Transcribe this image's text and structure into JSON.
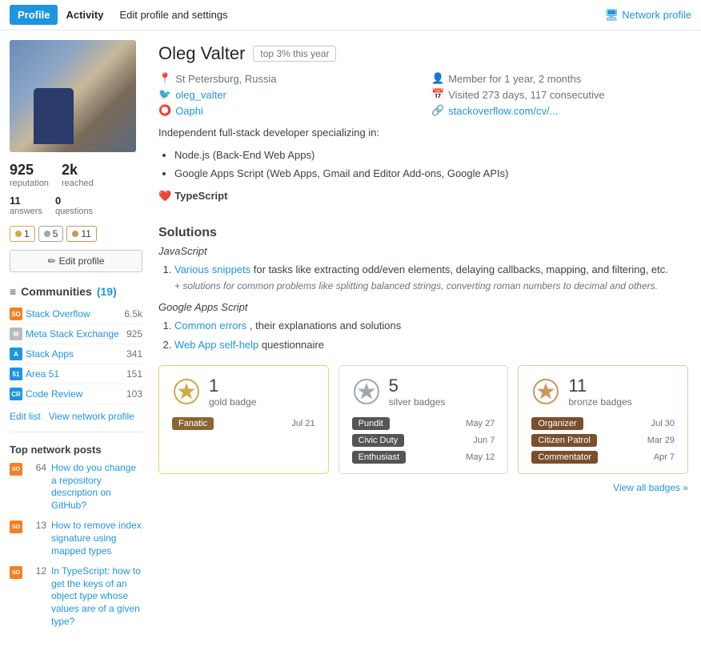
{
  "nav": {
    "profile_tab": "Profile",
    "activity_tab": "Activity",
    "edit_link": "Edit profile and settings",
    "network_profile": "Network profile"
  },
  "user": {
    "name": "Oleg Valter",
    "top_pct": "top 3% this year",
    "location": "St Petersburg, Russia",
    "member_since": "Member for 1 year, 2 months",
    "twitter": "oleg_valter",
    "visited": "Visited 273 days, 117 consecutive",
    "github": "Oaphi",
    "website": "stackoverflow.com/cv/...",
    "reputation": "925",
    "reputation_label": "reputation",
    "reached": "2k",
    "reached_label": "reached",
    "answers": "11",
    "answers_label": "answers",
    "questions": "0",
    "questions_label": "questions",
    "badge_gold": "1",
    "badge_silver": "5",
    "badge_bronze": "11",
    "edit_profile_btn": "Edit profile"
  },
  "bio": {
    "intro": "Independent full-stack developer specializing in:",
    "items": [
      "Node.js (Back-End Web Apps)",
      "Google Apps Script (Web Apps, Gmail and Editor Add-ons, Google APIs)"
    ],
    "ts_label": "TypeScript"
  },
  "solutions": {
    "title": "Solutions",
    "js_title": "JavaScript",
    "js_items": [
      {
        "link_text": "Various snippets",
        "link_rest": " for tasks like extracting odd/even elements, delaying callbacks, mapping, and filtering, etc.",
        "additional": "+ solutions for common problems like splitting balanced strings, converting roman numbers to decimal and others."
      }
    ],
    "gas_title": "Google Apps Script",
    "gas_items": [
      {
        "link_text": "Common errors",
        "link_rest": ", their explanations and solutions"
      },
      {
        "link_text": "Web App self-help",
        "link_rest": " questionnaire"
      }
    ]
  },
  "communities": {
    "title": "Communities",
    "count": "(19)",
    "items": [
      {
        "name": "Stack Overflow",
        "score": "6.5k",
        "icon": "so"
      },
      {
        "name": "Meta Stack Exchange",
        "score": "925",
        "icon": "meta"
      },
      {
        "name": "Stack Apps",
        "score": "341",
        "icon": "sa"
      },
      {
        "name": "Area 51",
        "score": "151",
        "icon": "area51"
      },
      {
        "name": "Code Review",
        "score": "103",
        "icon": "cr"
      }
    ],
    "edit_list": "Edit list",
    "view_network": "View network profile"
  },
  "top_posts": {
    "title": "Top network posts",
    "items": [
      {
        "score": "64",
        "text": "How do you change a repository description on GitHub?",
        "icon": "so"
      },
      {
        "score": "13",
        "text": "How to remove index signature using mapped types",
        "icon": "so"
      },
      {
        "score": "12",
        "text": "In TypeScript: how to get the keys of an object type whose values are of a given type?",
        "icon": "so"
      }
    ]
  },
  "badge_cards": {
    "gold": {
      "count": "1",
      "label": "gold badge",
      "entries": [
        {
          "name": "Fanatic",
          "color": "#8a6534",
          "date": "Jul 21"
        }
      ]
    },
    "silver": {
      "count": "5",
      "label": "silver badges",
      "entries": [
        {
          "name": "Pundit",
          "color": "#555",
          "date": "May 27"
        },
        {
          "name": "Civic Duty",
          "color": "#555",
          "date": "Jun 7"
        },
        {
          "name": "Enthusiast",
          "color": "#555",
          "date": "May 12"
        }
      ]
    },
    "bronze": {
      "count": "11",
      "label": "bronze badges",
      "entries": [
        {
          "name": "Organizer",
          "color": "#7a4f2e",
          "date": "Jul 30"
        },
        {
          "name": "Citizen Patrol",
          "color": "#7a4f2e",
          "date": "Mar 29"
        },
        {
          "name": "Commentator",
          "color": "#7a4f2e",
          "date": "Apr 7"
        }
      ]
    },
    "view_all": "View all badges »"
  }
}
